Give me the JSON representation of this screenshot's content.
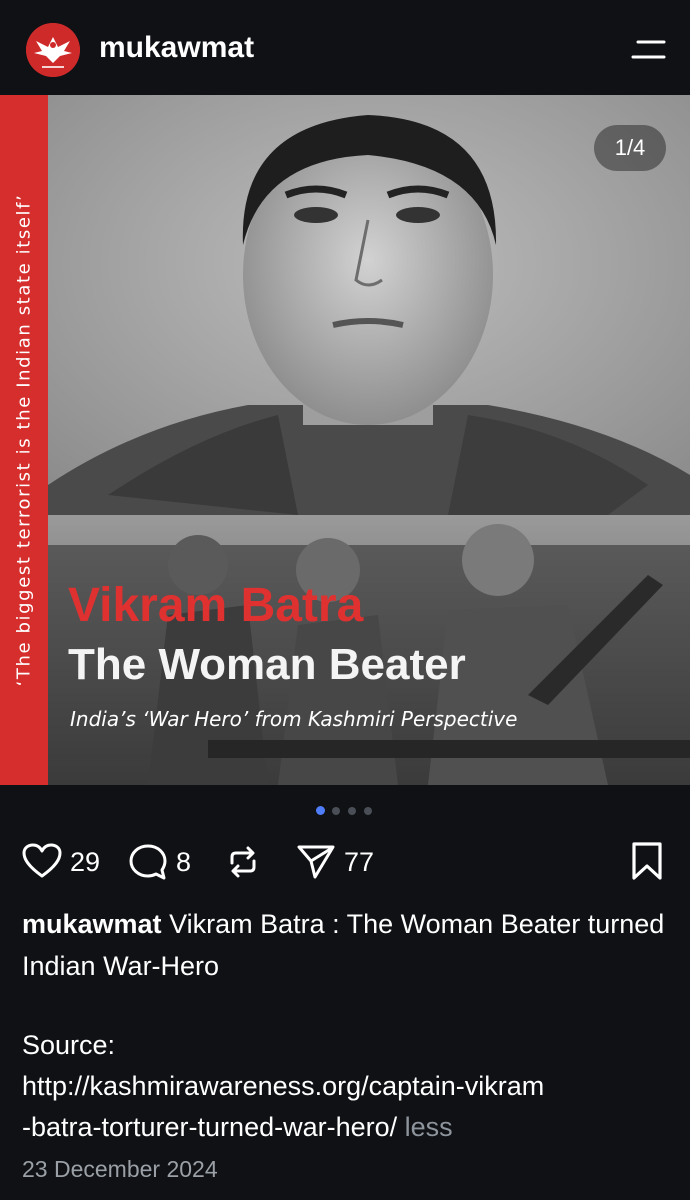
{
  "header": {
    "account_name": "mukawmat",
    "avatar_icon": "winged-emblem-icon",
    "menu_icon": "hamburger-menu-icon"
  },
  "media": {
    "side_text": "‘The biggest terrorist is the Indian state itself’",
    "counter": "1/4",
    "title_line1": "Vikram Batra",
    "title_line2": "The Woman Beater",
    "subtitle": "India’s ‘War Hero’ from Kashmiri Perspective",
    "dots_total": 4,
    "dots_active_index": 0
  },
  "actions": {
    "like_count": "29",
    "comment_count": "8",
    "share_count": "77",
    "icons": [
      "heart-icon",
      "comment-icon",
      "repost-icon",
      "send-icon",
      "bookmark-icon"
    ]
  },
  "caption": {
    "username": "mukawmat",
    "text": " Vikram Batra : The Woman Beater turned Indian War-Hero",
    "source_label": "Source:",
    "source_url_line1": "http://kashmirawareness.org/captain-vikram",
    "source_url_line2": "-batra-torturer-turned-war-hero/",
    "less_label": "less"
  },
  "post_date": "23 December 2024",
  "colors": {
    "background": "#0f1115",
    "accent_red": "#e03131",
    "strip_red": "#d62d2d",
    "active_dot": "#4f7cf7"
  }
}
